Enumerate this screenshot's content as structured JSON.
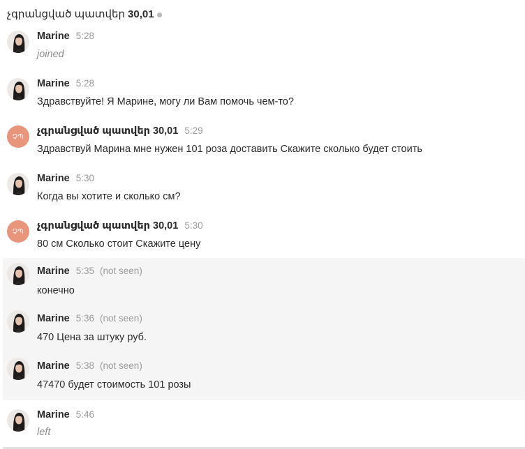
{
  "header": {
    "name": "չգրանցված պատվեր",
    "number": "30,01"
  },
  "messages": [
    {
      "author": "Marine",
      "time": "5:28",
      "status": "",
      "text": "joined",
      "kind": "system",
      "avatar": "photo"
    },
    {
      "author": "Marine",
      "time": "5:28",
      "status": "",
      "text": "Здравствуйте! Я Марине, могу ли Вам помочь чем-то?",
      "kind": "normal",
      "avatar": "photo"
    },
    {
      "author": "չգրանցված պատվեր 30,01",
      "time": "5:29",
      "status": "",
      "text": "Здравствуй Марина мне нужен 101 роза доставить Скажите сколько будет стоить",
      "kind": "normal",
      "avatar": "initials",
      "initials": "ՉՊ"
    },
    {
      "author": "Marine",
      "time": "5:30",
      "status": "",
      "text": "Когда вы хотите и сколько см?",
      "kind": "normal",
      "avatar": "photo"
    },
    {
      "author": "չգրանցված պատվեր 30,01",
      "time": "5:30",
      "status": "",
      "text": "80 см Сколько стоит Скажите цену",
      "kind": "normal",
      "avatar": "initials",
      "initials": "ՉՊ"
    },
    {
      "author": "Marine",
      "time": "5:35",
      "status": "(not seen)",
      "text": "конечно",
      "kind": "unseen",
      "avatar": "photo"
    },
    {
      "author": "Marine",
      "time": "5:36",
      "status": "(not seen)",
      "text": "470 Цена за штуку руб.",
      "kind": "unseen",
      "avatar": "photo"
    },
    {
      "author": "Marine",
      "time": "5:38",
      "status": "(not seen)",
      "text": "47470 будет стоимость 101 розы",
      "kind": "unseen",
      "avatar": "photo"
    },
    {
      "author": "Marine",
      "time": "5:46",
      "status": "",
      "text": "left",
      "kind": "system",
      "avatar": "photo"
    }
  ],
  "colors": {
    "initials_avatar": "#e8957c",
    "unseen_background": "#f5f5f5",
    "muted_text": "#9a9a9a"
  }
}
